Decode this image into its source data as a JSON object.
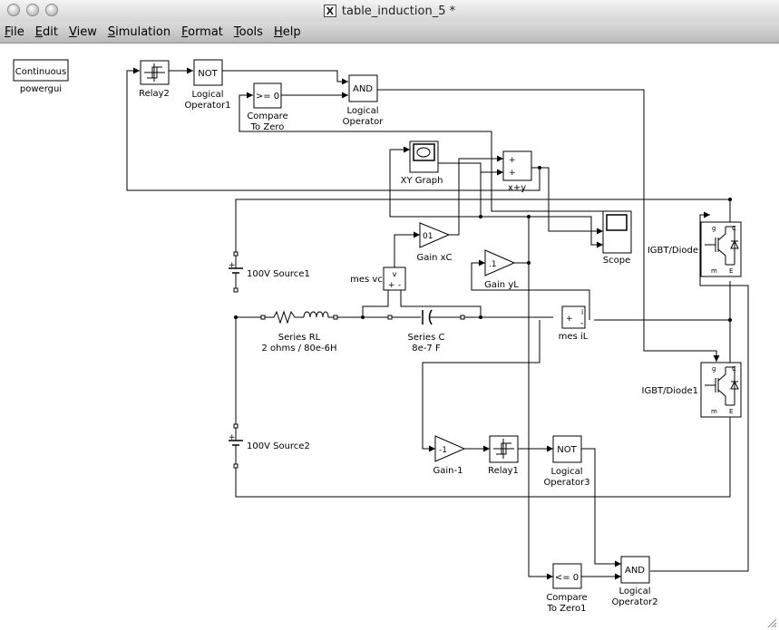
{
  "window": {
    "title": "table_induction_5 *"
  },
  "menu": [
    {
      "label": "File",
      "ul": "F",
      "rest": "ile"
    },
    {
      "label": "Edit",
      "ul": "E",
      "rest": "dit"
    },
    {
      "label": "View",
      "ul": "V",
      "rest": "iew"
    },
    {
      "label": "Simulation",
      "ul": "S",
      "rest": "imulation"
    },
    {
      "label": "Format",
      "ul": "F",
      "rest": "ormat"
    },
    {
      "label": "Tools",
      "ul": "T",
      "rest": "ools"
    },
    {
      "label": "Help",
      "ul": "H",
      "rest": "elp"
    }
  ],
  "blocks": {
    "powergui": {
      "text": "Continuous",
      "label": "powergui"
    },
    "relay2": {
      "label": "Relay2"
    },
    "not1": {
      "text": "NOT",
      "label1": "Logical",
      "label2": "Operator1"
    },
    "and1": {
      "text": "AND",
      "label1": "Logical",
      "label2": "Operator"
    },
    "cmp1": {
      "text": ">= 0",
      "label1": "Compare",
      "label2": "To Zero"
    },
    "xygraph": {
      "label": "XY Graph"
    },
    "sum": {
      "plus1": "+",
      "plus2": "+",
      "label": "x+y"
    },
    "scope": {
      "label": "Scope"
    },
    "gainxc": {
      "text": "01",
      "label": "Gain xC"
    },
    "gainyl": {
      "text": ".1",
      "label": "Gain yL"
    },
    "mesvc": {
      "label": "mes vc",
      "port_v": "v",
      "plus": "+",
      "minus": "-"
    },
    "mesil": {
      "label": "mes iL",
      "port_i": "i",
      "plus": "+",
      "minus": "-"
    },
    "src1": {
      "label": "100V Source1",
      "plus": "+"
    },
    "src2": {
      "label": "100V Source2",
      "plus": "+"
    },
    "rl": {
      "label1": "Series RL",
      "label2": "2 ohms / 80e-6H"
    },
    "c": {
      "label1": "Series C",
      "label2": "8e-7 F"
    },
    "igbt1": {
      "label": "IGBT/Diode",
      "g": "g",
      "c": "C",
      "m": "m",
      "e": "E"
    },
    "igbt2": {
      "label": "IGBT/Diode1",
      "g": "g",
      "c": "C",
      "m": "m",
      "e": "E"
    },
    "gainm1": {
      "text": "-1",
      "label": "Gain-1"
    },
    "relay1": {
      "label": "Relay1"
    },
    "not3": {
      "text": "NOT",
      "label1": "Logical",
      "label2": "Operator3"
    },
    "cmp2": {
      "text": "<= 0",
      "label1": "Compare",
      "label2": "To Zero1"
    },
    "and2": {
      "text": "AND",
      "label1": "Logical",
      "label2": "Operator2"
    }
  }
}
